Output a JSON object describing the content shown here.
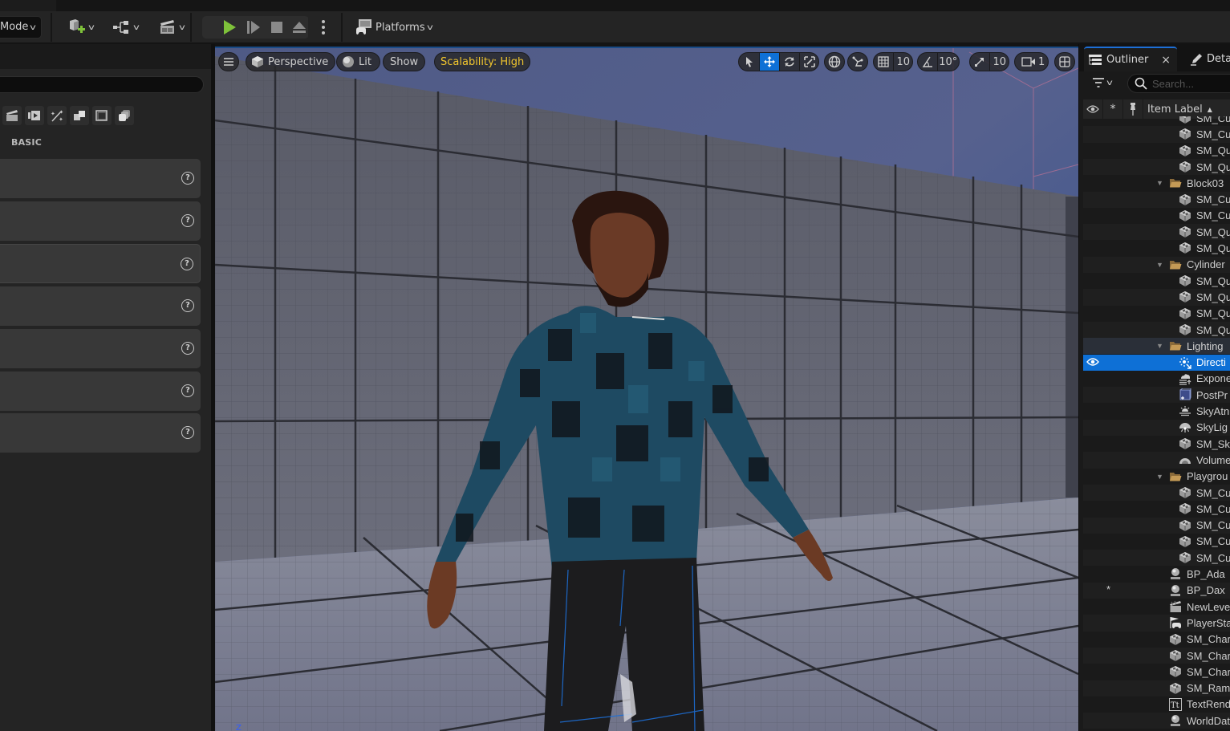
{
  "toolbar": {
    "mode_label": "Mode",
    "platforms_label": "Platforms",
    "icons": {
      "add": "add-actor-icon",
      "blueprint": "blueprint-icon",
      "cinematics": "cinematics-icon",
      "play": "play-icon",
      "advance": "advance-frame-icon",
      "stop": "stop-icon",
      "eject": "eject-icon",
      "more": "more-options-icon",
      "platforms": "platforms-icon"
    },
    "play_color": "#7ec13a"
  },
  "left_panel": {
    "search_value": "",
    "category_icons": [
      "cinematic-icon",
      "media-icon",
      "visual-effects-icon",
      "geometry-icon",
      "volume-icon",
      "all-classes-icon"
    ],
    "section_label": "BASIC",
    "items": [
      {
        "label": ""
      },
      {
        "label": ""
      },
      {
        "label": ""
      },
      {
        "label": ""
      },
      {
        "label": ""
      },
      {
        "label": ""
      },
      {
        "label": ""
      }
    ]
  },
  "viewport": {
    "menu_icon": "hamburger-icon",
    "view_mode": "Perspective",
    "lighting_mode": "Lit",
    "show_label": "Show",
    "scalability_label": "Scalability: High",
    "scalability_color": "#f2c62d",
    "transform_tools": [
      "select",
      "translate",
      "rotate",
      "scale"
    ],
    "active_tool": "translate",
    "grid_snap": "10",
    "rotation_snap": "10°",
    "scale_snap": "10",
    "camera_speed": "1",
    "accent_color": "#0e70d6"
  },
  "outliner": {
    "tab_label": "Outliner",
    "details_tab_label": "Deta",
    "search_placeholder": "Search...",
    "column_label": "Item Label",
    "sort_indicator": "▲",
    "selection_color": "#0e70d6",
    "rows": [
      {
        "label": "SM_Cu",
        "icon": "static-mesh",
        "level": 2
      },
      {
        "label": "SM_Cu",
        "icon": "static-mesh",
        "level": 2
      },
      {
        "label": "SM_Qu",
        "icon": "static-mesh",
        "level": 2
      },
      {
        "label": "SM_Qu",
        "icon": "static-mesh",
        "level": 2
      },
      {
        "label": "Block03",
        "icon": "folder",
        "level": 1,
        "expanded": true
      },
      {
        "label": "SM_Cu",
        "icon": "static-mesh",
        "level": 2
      },
      {
        "label": "SM_Cu",
        "icon": "static-mesh",
        "level": 2
      },
      {
        "label": "SM_Qu",
        "icon": "static-mesh",
        "level": 2
      },
      {
        "label": "SM_Qu",
        "icon": "static-mesh",
        "level": 2
      },
      {
        "label": "Cylinder",
        "icon": "folder",
        "level": 1,
        "expanded": true
      },
      {
        "label": "SM_Qu",
        "icon": "static-mesh",
        "level": 2
      },
      {
        "label": "SM_Qu",
        "icon": "static-mesh",
        "level": 2
      },
      {
        "label": "SM_Qu",
        "icon": "static-mesh",
        "level": 2
      },
      {
        "label": "SM_Qu",
        "icon": "static-mesh",
        "level": 2
      },
      {
        "label": "Lighting",
        "icon": "folder",
        "level": 1,
        "expanded": true,
        "highlight": true
      },
      {
        "label": "Directi",
        "icon": "directional-light",
        "level": 2,
        "selected": true,
        "visible": true
      },
      {
        "label": "Expone",
        "icon": "exponential-fog",
        "level": 2
      },
      {
        "label": "PostPr",
        "icon": "post-process",
        "level": 2
      },
      {
        "label": "SkyAtn",
        "icon": "sky-atmosphere",
        "level": 2
      },
      {
        "label": "SkyLig",
        "icon": "sky-light",
        "level": 2
      },
      {
        "label": "SM_Sk",
        "icon": "static-mesh",
        "level": 2
      },
      {
        "label": "Volume",
        "icon": "volumetric-cloud",
        "level": 2
      },
      {
        "label": "Playgrou",
        "icon": "folder",
        "level": 1,
        "expanded": true
      },
      {
        "label": "SM_Cu",
        "icon": "static-mesh",
        "level": 2
      },
      {
        "label": "SM_Cu",
        "icon": "static-mesh",
        "level": 2
      },
      {
        "label": "SM_Cu",
        "icon": "static-mesh",
        "level": 2
      },
      {
        "label": "SM_Cu",
        "icon": "static-mesh",
        "level": 2
      },
      {
        "label": "SM_Cu",
        "icon": "static-mesh",
        "level": 2
      },
      {
        "label": "BP_Ada",
        "icon": "blueprint-actor",
        "level": 1
      },
      {
        "label": "BP_Dax",
        "icon": "blueprint-actor",
        "level": 1,
        "starred": true
      },
      {
        "label": "NewLeve",
        "icon": "level-sequence",
        "level": 1
      },
      {
        "label": "PlayerSta",
        "icon": "player-start",
        "level": 1
      },
      {
        "label": "SM_Char",
        "icon": "static-mesh",
        "level": 1
      },
      {
        "label": "SM_Char",
        "icon": "static-mesh",
        "level": 1
      },
      {
        "label": "SM_Char",
        "icon": "static-mesh",
        "level": 1
      },
      {
        "label": "SM_Ram",
        "icon": "static-mesh",
        "level": 1
      },
      {
        "label": "TextRend",
        "icon": "text-render",
        "level": 1
      },
      {
        "label": "WorldDat",
        "icon": "blueprint-actor",
        "level": 1
      }
    ]
  }
}
